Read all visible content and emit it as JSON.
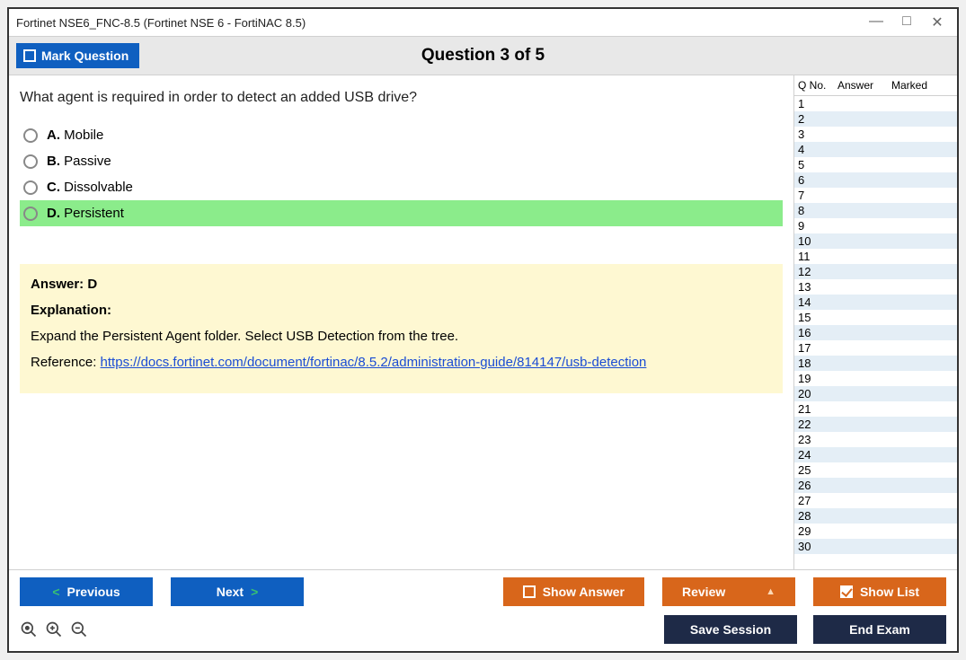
{
  "window": {
    "title": "Fortinet NSE6_FNC-8.5 (Fortinet NSE 6 - FortiNAC 8.5)"
  },
  "header": {
    "mark_label": "Mark Question",
    "question_title": "Question 3 of 5"
  },
  "question": {
    "text": "What agent is required in order to detect an added USB drive?",
    "options": [
      {
        "letter": "A.",
        "text": "Mobile",
        "highlight": false
      },
      {
        "letter": "B.",
        "text": "Passive",
        "highlight": false
      },
      {
        "letter": "C.",
        "text": "Dissolvable",
        "highlight": false
      },
      {
        "letter": "D.",
        "text": "Persistent",
        "highlight": true
      }
    ]
  },
  "answer": {
    "label": "Answer: D",
    "explanation_label": "Explanation:",
    "explanation_text": "Expand the Persistent Agent folder. Select USB Detection from the tree.",
    "reference_label": "Reference: ",
    "reference_link": "https://docs.fortinet.com/document/fortinac/8.5.2/administration-guide/814147/usb-detection"
  },
  "side": {
    "col1": "Q No.",
    "col2": "Answer",
    "col3": "Marked",
    "rows": [
      1,
      2,
      3,
      4,
      5,
      6,
      7,
      8,
      9,
      10,
      11,
      12,
      13,
      14,
      15,
      16,
      17,
      18,
      19,
      20,
      21,
      22,
      23,
      24,
      25,
      26,
      27,
      28,
      29,
      30
    ]
  },
  "buttons": {
    "previous": "Previous",
    "next": "Next",
    "show_answer": "Show Answer",
    "review": "Review",
    "show_list": "Show List",
    "save_session": "Save Session",
    "end_exam": "End Exam"
  }
}
